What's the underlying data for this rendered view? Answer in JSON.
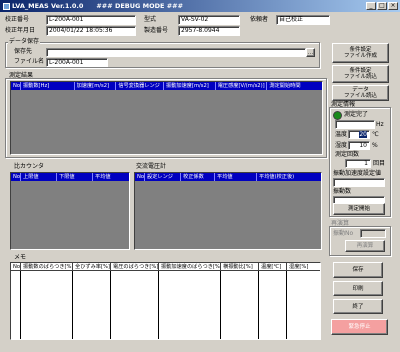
{
  "window": {
    "title": "LVA_MEAS Ver.1.0.0　　### DEBUG MODE ###"
  },
  "header": {
    "calib_no_label": "校正番号",
    "calib_no": "L-200A-001",
    "calib_date_label": "校正年月日",
    "calib_date": "2004/01/22 18:05:36",
    "model_label": "型式",
    "model": "VA-SV-02",
    "serial_label": "製造番号",
    "serial": "2957-8.0944",
    "recipient_label": "依頼者",
    "recipient": "自己校正"
  },
  "data_save": {
    "group_label": "データ保存",
    "dest_label": "保存先",
    "dest": "",
    "filename_label": "ファイル名",
    "filename": "L-200A-001"
  },
  "buttons": {
    "cond_create": "条件設定\nファイル作成",
    "cond_load": "条件設定\nファイル読込",
    "data_load": "データ\nファイル読込",
    "measure_start": "測定開始",
    "recalc": "再演算",
    "save": "保存",
    "print": "印刷",
    "exit": "終了",
    "emergency_stop": "緊急停止"
  },
  "results": {
    "group_label": "測定結果",
    "columns": [
      "No",
      "振動数[Hz]",
      "加速度[m/s2]",
      "信号変換器レンジ",
      "振動加速度[m/s2]",
      "電圧感度[V/(m/s2)]",
      "測定開始時間"
    ]
  },
  "counter": {
    "group_label": "比カウンタ",
    "columns": [
      "No",
      "上限値",
      "下限値",
      "平均値"
    ]
  },
  "ac_meter": {
    "group_label": "交流電圧計",
    "columns": [
      "No",
      "設定レンジ",
      "校正係数",
      "平均値",
      "平均値(校正後)"
    ]
  },
  "memo": {
    "group_label": "メモ",
    "columns": [
      "No",
      "振動数のばらつき[%]",
      "全ひずみ率[%]",
      "電圧のばらつき[%]",
      "振動加速度のばらつき[%]",
      "横振動比[%]",
      "温度[℃]",
      "湿度[%]"
    ]
  },
  "measure_info": {
    "group_label": "測定情報",
    "status": "測定完了",
    "freq_value": "",
    "freq_unit": "Hz",
    "temp_label": "温度",
    "temp_value": "20",
    "temp_unit": "℃",
    "humid_label": "湿度",
    "humid_value": "10",
    "humid_unit": "%",
    "count_label": "測定回数",
    "count_value": "1",
    "count_unit": "回目",
    "accel_label": "振動加速度設定値",
    "freq_set_label": "振動数"
  },
  "recalc": {
    "group_label": "再演算",
    "no_label": "振動No"
  }
}
